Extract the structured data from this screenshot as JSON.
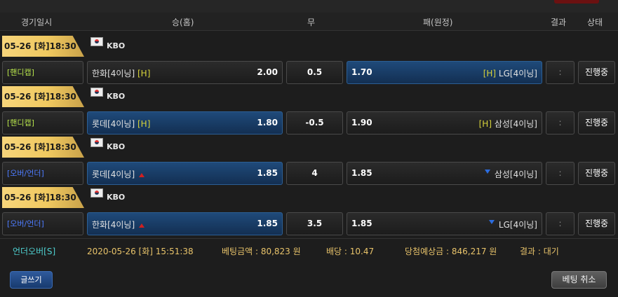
{
  "header": {
    "date_time": "경기일시",
    "home": "승(홈)",
    "draw": "무",
    "away": "패(원정)",
    "result": "결과",
    "status": "상태"
  },
  "games": [
    {
      "date": "05-26 [화]18:30",
      "league": "KBO",
      "type": "[핸디캡]",
      "home_team": "한화[4이닝]",
      "home_tag": "[H]",
      "home_odds": "2.00",
      "draw_value": "0.5",
      "away_odds": "1.70",
      "away_tag": "[H]",
      "away_team": "LG[4이닝]",
      "result": ":",
      "status": "진행중",
      "selected": "away"
    },
    {
      "date": "05-26 [화]18:30",
      "league": "KBO",
      "type": "[핸디캡]",
      "home_team": "롯데[4이닝]",
      "home_tag": "[H]",
      "home_odds": "1.80",
      "draw_value": "-0.5",
      "away_odds": "1.90",
      "away_tag": "[H]",
      "away_team": "삼성[4이닝]",
      "result": ":",
      "status": "진행중",
      "selected": "home"
    },
    {
      "date": "05-26 [화]18:30",
      "league": "KBO",
      "type": "[오버/언더]",
      "home_team": "롯데[4이닝]",
      "home_odds": "1.85",
      "draw_value": "4",
      "away_odds": "1.85",
      "away_team": "삼성[4이닝]",
      "result": ":",
      "status": "진행중",
      "selected": "home"
    },
    {
      "date": "05-26 [화]18:30",
      "league": "KBO",
      "type": "[오버/언더]",
      "home_team": "한화[4이닝]",
      "home_odds": "1.85",
      "draw_value": "3.5",
      "away_odds": "1.85",
      "away_team": "LG[4이닝]",
      "result": ":",
      "status": "진행중",
      "selected": "home"
    }
  ],
  "summary": {
    "bet_type": "언더오버[S]",
    "datetime": "2020-05-26 [화] 15:51:38",
    "bet_amount": "베팅금액 : 80,823 원",
    "rate": "배당 : 10.47",
    "expected_win": "당첨예상금 : 846,217 원",
    "result": "결과 : 대기"
  },
  "buttons": {
    "write": "글쓰기",
    "cancel": "베팅 취소"
  },
  "colors": {
    "date_tab": "#f0c960",
    "handicap_type": "#b6e34b",
    "overunder_type": "#4d7bff",
    "selected_box": "#1f4a7a",
    "summary_text": "#e8c36a",
    "summary_type": "#4fd1d1"
  }
}
